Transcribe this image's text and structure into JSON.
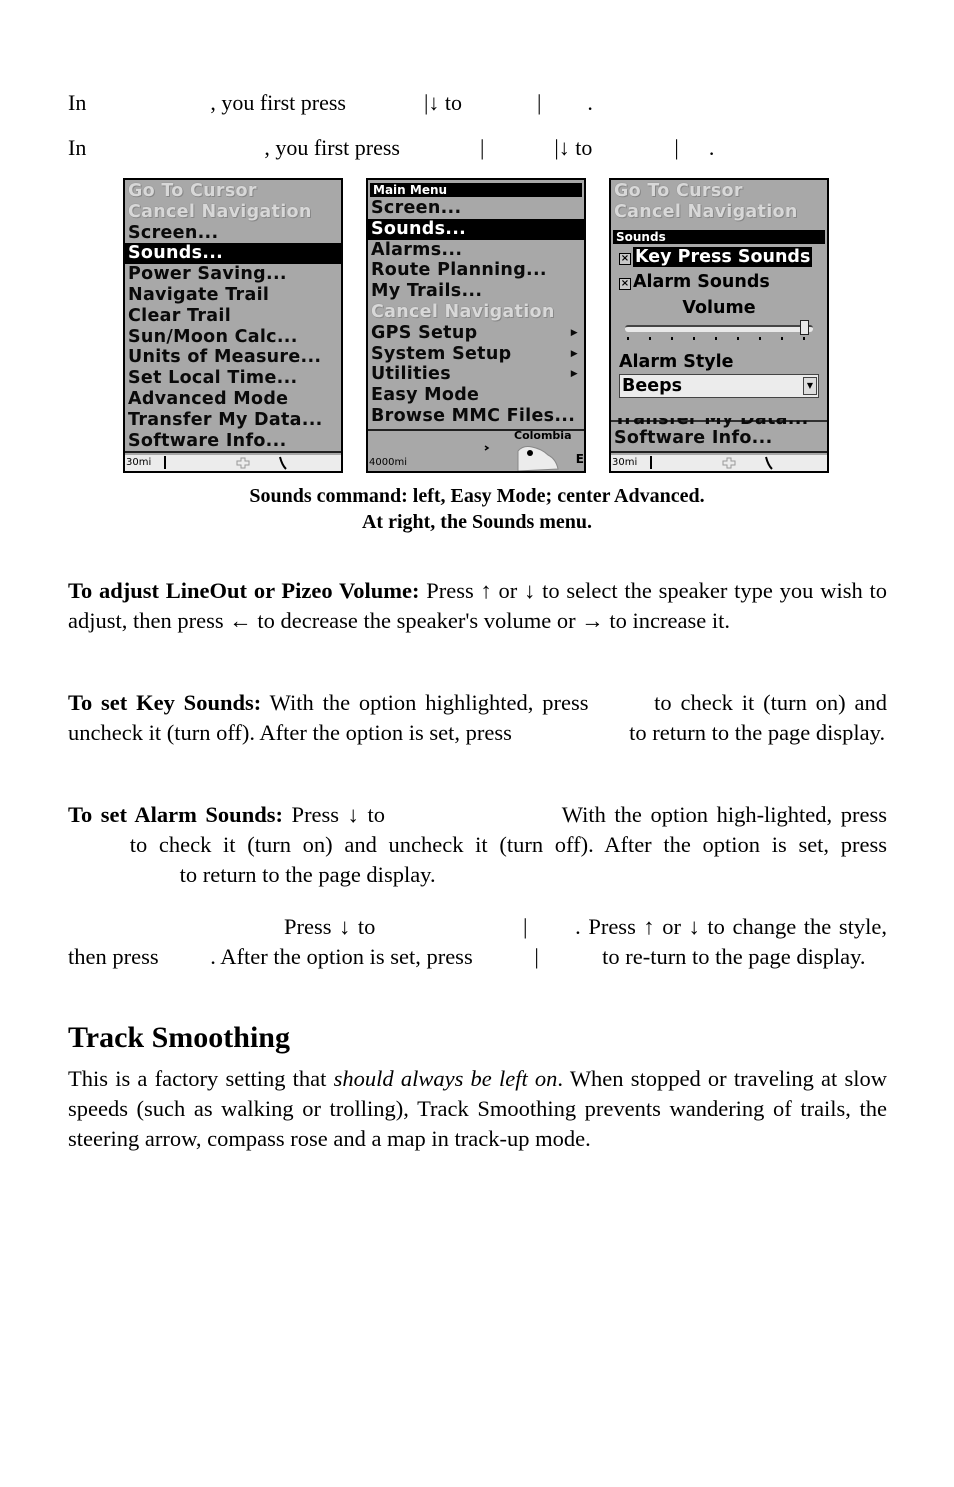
{
  "intro": {
    "line1": {
      "a": "In",
      "b": ", you first press",
      "c": "|↓ to",
      "d": "|",
      "e": "."
    },
    "line2": {
      "a": "In",
      "b": ", you first press",
      "c": "|",
      "d": "|↓ to",
      "e": "|",
      "f": "."
    }
  },
  "screens": {
    "easy": {
      "items": [
        {
          "label": "Go To Cursor",
          "state": "disabled"
        },
        {
          "label": "Cancel Navigation",
          "state": "disabled"
        },
        {
          "label": "Screen...",
          "state": "normal"
        },
        {
          "label": "Sounds...",
          "state": "selected"
        },
        {
          "label": "Power Saving...",
          "state": "normal"
        },
        {
          "label": "Navigate Trail",
          "state": "normal"
        },
        {
          "label": "Clear Trail",
          "state": "normal"
        },
        {
          "label": "Sun/Moon Calc...",
          "state": "normal"
        },
        {
          "label": "Units of Measure...",
          "state": "normal"
        },
        {
          "label": "Set Local Time...",
          "state": "normal"
        },
        {
          "label": "Advanced Mode",
          "state": "normal"
        },
        {
          "label": "Transfer My Data...",
          "state": "normal"
        },
        {
          "label": "Software Info...",
          "state": "normal"
        }
      ],
      "map_scale": "30mi"
    },
    "advanced": {
      "header": "Main Menu",
      "items": [
        {
          "label": "Screen...",
          "state": "normal"
        },
        {
          "label": "Sounds...",
          "state": "selected"
        },
        {
          "label": "Alarms...",
          "state": "normal"
        },
        {
          "label": "Route Planning...",
          "state": "normal"
        },
        {
          "label": "My Trails...",
          "state": "normal"
        },
        {
          "label": "Cancel Navigation",
          "state": "disabled"
        },
        {
          "label": "GPS Setup",
          "state": "normal",
          "submenu": true
        },
        {
          "label": "System Setup",
          "state": "normal",
          "submenu": true
        },
        {
          "label": "Utilities",
          "state": "normal",
          "submenu": true
        },
        {
          "label": "Easy Mode",
          "state": "normal"
        },
        {
          "label": "Browse MMC Files...",
          "state": "normal"
        }
      ],
      "map_scale": "4000mi",
      "map_label": "Colombia"
    },
    "sounds": {
      "bg_items": [
        {
          "label": "Go To Cursor",
          "state": "disabled"
        },
        {
          "label": "Cancel Navigation",
          "state": "disabled"
        }
      ],
      "header": "Sounds",
      "key_press_sounds": {
        "label": "Key Press Sounds",
        "checked": true
      },
      "alarm_sounds": {
        "label": "Alarm Sounds",
        "checked": true
      },
      "volume_label": "Volume",
      "volume_level": 1.0,
      "volume_ticks": 9,
      "alarm_style_label": "Alarm Style",
      "alarm_style_value": "Beeps",
      "peek_item": "Transfer My Data...",
      "bottom_item": "Software Info...",
      "map_scale": "30mi"
    }
  },
  "caption": {
    "line1": "Sounds command: left, Easy Mode; center Advanced.",
    "line2": "At right, the Sounds menu."
  },
  "paragraphs": {
    "lineout": {
      "title": "To adjust LineOut or Pizeo Volume:",
      "text": " Press ↑ or ↓ to select the speaker type you wish to adjust, then press ← to decrease the speaker's volume or → to increase it."
    },
    "key_sounds": {
      "title": "To set Key Sounds:",
      "t1": " With the option highlighted, press ",
      "t2": " to check it (turn on) and uncheck it (turn off). After the option is set, press ",
      "t3": " to return to the page display."
    },
    "alarm_sounds": {
      "title": "To set Alarm Sounds:",
      "t1": " Press ↓ to ",
      "t2": " With the option high-lighted, press ",
      "t3": " to check it (turn on) and uncheck it (turn off). After the option is set, press ",
      "t4": " to return to the page display."
    },
    "alarm_style": {
      "t1": "Press ↓ to ",
      "t2": "| ",
      "t3": ". Press ↑ or ↓ to change the style, then press ",
      "t4": ". After the option is set, press ",
      "t5": "| ",
      "t6": " to re-turn to the page display."
    }
  },
  "track_smoothing": {
    "heading": "Track Smoothing",
    "t1": "This is a factory setting that ",
    "emphasis": "should always be left on",
    "t2": ". When stopped or traveling at slow speeds (such as walking or trolling), Track Smoothing prevents wandering of trails, the steering arrow, compass rose and a map in track-up mode."
  }
}
